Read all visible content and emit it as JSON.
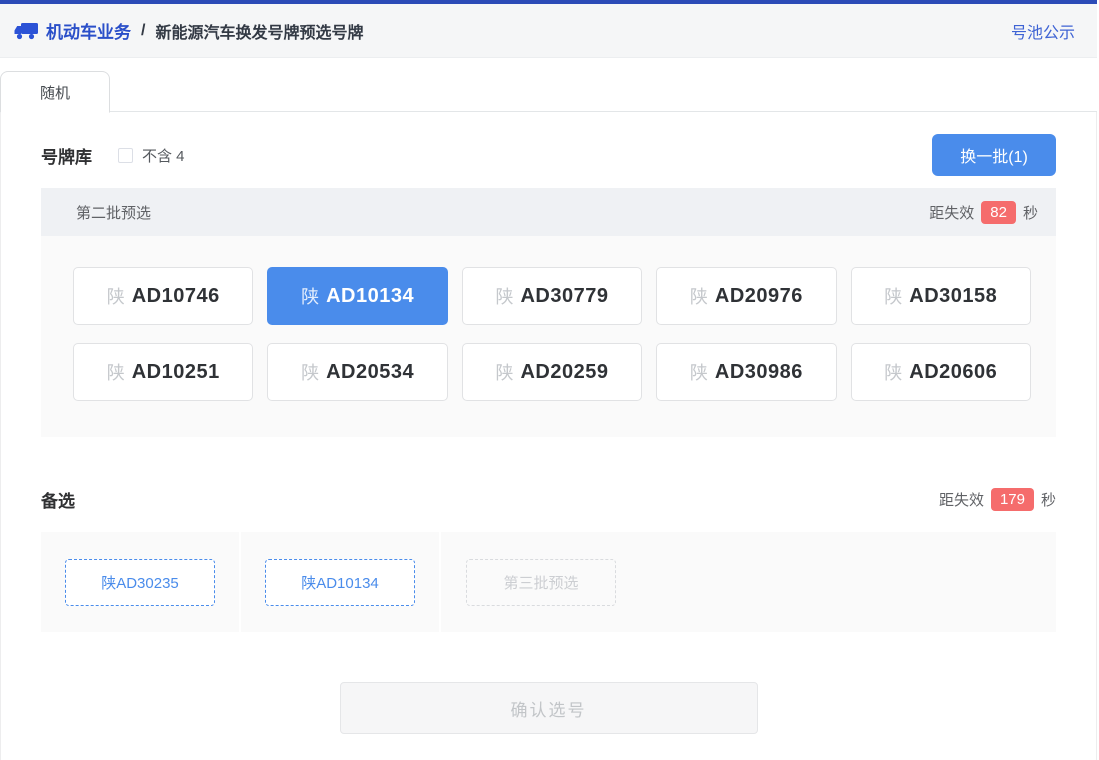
{
  "colors": {
    "topline": "#2b4bb7",
    "primary_blue": "#4a8ceb",
    "badge_red": "#f56c6c",
    "brand_blue": "#2a4fc9",
    "link_blue": "#3e63d4"
  },
  "header": {
    "brand": "机动车业务",
    "separator": "/",
    "title": "新能源汽车换发号牌预选号牌",
    "link": "号池公示"
  },
  "tabs": [
    {
      "label": "随机",
      "active": true
    }
  ],
  "pool": {
    "label": "号牌库",
    "checkbox_label": "不含 4",
    "checkbox_checked": false,
    "refresh_button": "换一批(1)",
    "batch_title": "第二批预选",
    "expiry_prefix": "距失效",
    "expiry_seconds": "82",
    "expiry_suffix": "秒",
    "plates": [
      {
        "prefix": "陕",
        "number": "AD10746",
        "selected": false
      },
      {
        "prefix": "陕",
        "number": "AD10134",
        "selected": true
      },
      {
        "prefix": "陕",
        "number": "AD30779",
        "selected": false
      },
      {
        "prefix": "陕",
        "number": "AD20976",
        "selected": false
      },
      {
        "prefix": "陕",
        "number": "AD30158",
        "selected": false
      },
      {
        "prefix": "陕",
        "number": "AD10251",
        "selected": false
      },
      {
        "prefix": "陕",
        "number": "AD20534",
        "selected": false
      },
      {
        "prefix": "陕",
        "number": "AD20259",
        "selected": false
      },
      {
        "prefix": "陕",
        "number": "AD30986",
        "selected": false
      },
      {
        "prefix": "陕",
        "number": "AD20606",
        "selected": false
      }
    ]
  },
  "alternatives": {
    "label": "备选",
    "expiry_prefix": "距失效",
    "expiry_seconds": "179",
    "expiry_suffix": "秒",
    "items": [
      {
        "label": "陕AD30235",
        "disabled": false
      },
      {
        "label": "陕AD10134",
        "disabled": false
      },
      {
        "label": "第三批预选",
        "disabled": true
      }
    ]
  },
  "confirm_button": "确认选号"
}
